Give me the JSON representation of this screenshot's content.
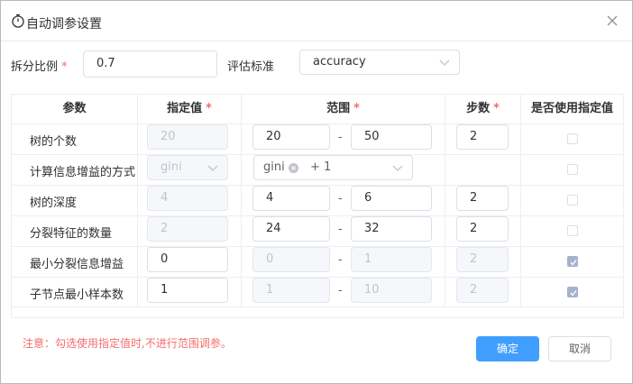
{
  "dialog": {
    "title": "自动调参设置",
    "close_icon": "close-icon"
  },
  "split": {
    "label": "拆分比例",
    "required": "*",
    "value": "0.7"
  },
  "metric": {
    "label": "评估标准",
    "value": "accuracy"
  },
  "table": {
    "headers": {
      "param": "参数",
      "value": "指定值",
      "range": "范围",
      "step": "步数",
      "use": "是否使用指定值"
    },
    "required_mark": "*",
    "dash": "-",
    "rows": [
      {
        "name": "树的个数",
        "value": "20",
        "min": "20",
        "max": "50",
        "step": "2",
        "checked": false
      },
      {
        "name": "计算信息增益的方式",
        "value": "gini",
        "tag": "gini",
        "more": "+ 1",
        "checked": false
      },
      {
        "name": "树的深度",
        "value": "4",
        "min": "4",
        "max": "6",
        "step": "2",
        "checked": false
      },
      {
        "name": "分裂特征的数量",
        "value": "2",
        "min": "24",
        "max": "32",
        "step": "2",
        "checked": false
      },
      {
        "name": "最小分裂信息增益",
        "value": "0",
        "min": "0",
        "max": "1",
        "step": "2",
        "checked": true
      },
      {
        "name": "子节点最小样本数",
        "value": "1",
        "min": "1",
        "max": "10",
        "step": "2",
        "checked": true
      }
    ]
  },
  "note": "注意：勾选使用指定值时,不进行范围调参。",
  "buttons": {
    "confirm": "确定",
    "cancel": "取消"
  },
  "colors": {
    "primary": "#409eff",
    "required": "#f56c6c",
    "checked": "#a4b2cf"
  }
}
